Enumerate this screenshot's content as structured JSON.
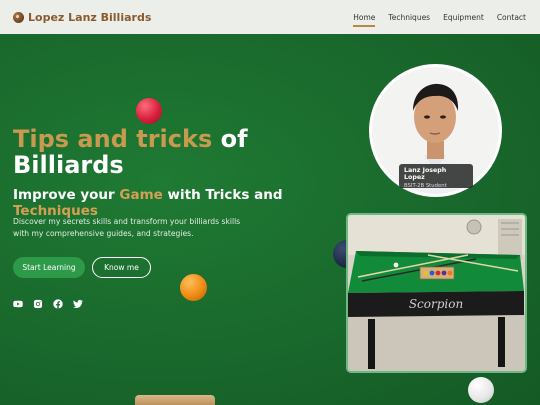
{
  "nav": {
    "brand": "Lopez Lanz Billiards",
    "links": [
      "Home",
      "Techniques",
      "Equipment",
      "Contact"
    ],
    "active": "Home"
  },
  "hero": {
    "title_accent": "Tips and tricks",
    "title_rest": " of Billiards",
    "subtitle_a": "Improve your ",
    "subtitle_b": "Game",
    "subtitle_c": " with Tricks and ",
    "subtitle_d": "Techniques",
    "description": "Discover my secrets skills and transform your billiards skills with my comprehensive guides, and strategies.",
    "btn_start": "Start Learning",
    "btn_know": "Know me"
  },
  "socials": [
    "youtube-icon",
    "instagram-icon",
    "facebook-icon",
    "twitter-icon"
  ],
  "profile": {
    "name": "Lanz Joseph Lopez",
    "role": "BSIT-2B Student"
  },
  "colors": {
    "felt": "#1c6a2e",
    "accent_gold": "#c79a4f",
    "button_green": "#2c9a48",
    "navbar": "#ecefe9"
  }
}
